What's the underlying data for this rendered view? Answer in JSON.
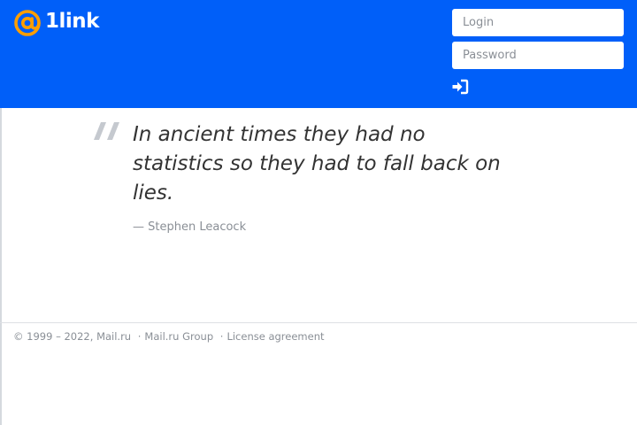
{
  "header": {
    "brand_text": "1link",
    "brand_color": "#005ff9",
    "accent_color": "#ff9e00",
    "login": {
      "placeholder": "Login",
      "value": ""
    },
    "password": {
      "placeholder": "Password",
      "value": ""
    },
    "signin_icon": "sign-in-icon"
  },
  "quote": {
    "mark_icon": "quote-mark-icon",
    "text": "In ancient times they had no statistics so they had to fall back on lies.",
    "author": "— Stephen Leacock"
  },
  "footer": {
    "copyright": "© 1999 – 2022,",
    "links": [
      "Mail.ru",
      "Mail.ru Group",
      "License agreement"
    ],
    "separator": "·"
  }
}
